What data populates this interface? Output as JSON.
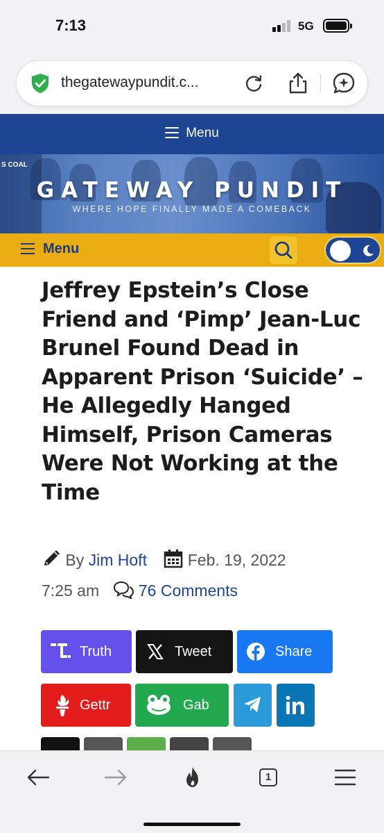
{
  "status": {
    "time": "7:13",
    "network": "5G"
  },
  "browser": {
    "url": "thegatewaypundit.c...",
    "tabs_count": "1"
  },
  "site": {
    "top_menu_label": "Menu",
    "banner_title": "GATEWAY PUNDIT",
    "banner_tagline": "WHERE HOPE FINALLY MADE A COMEBACK",
    "banner_sign_text": "S COAL",
    "secondary_menu_label": "Menu"
  },
  "article": {
    "title": "Jeffrey Epstein’s Close Friend and ‘Pimp’ Jean-Luc Brunel Found Dead in Apparent Prison ‘Suicide’ – He Allegedly Hanged Himself, Prison Cameras Were Not Working at the Time",
    "by_label": "By",
    "author": "Jim Hoft",
    "date": "Feb. 19, 2022",
    "time": "7:25 am",
    "comments": "76 Comments"
  },
  "share_buttons": [
    {
      "label": "Truth",
      "color": "#6450ea"
    },
    {
      "label": "Tweet",
      "color": "#141414"
    },
    {
      "label": "Share",
      "color": "#1778f2"
    },
    {
      "label": "Gettr",
      "color": "#e31c1c"
    },
    {
      "label": "Gab",
      "color": "#22a94f"
    },
    {
      "label": "",
      "color": "#2a9ad8"
    },
    {
      "label": "",
      "color": "#0a76b5"
    }
  ],
  "colors": {
    "nav_blue": "#1e4594",
    "nav_yellow": "#e9ac12"
  }
}
